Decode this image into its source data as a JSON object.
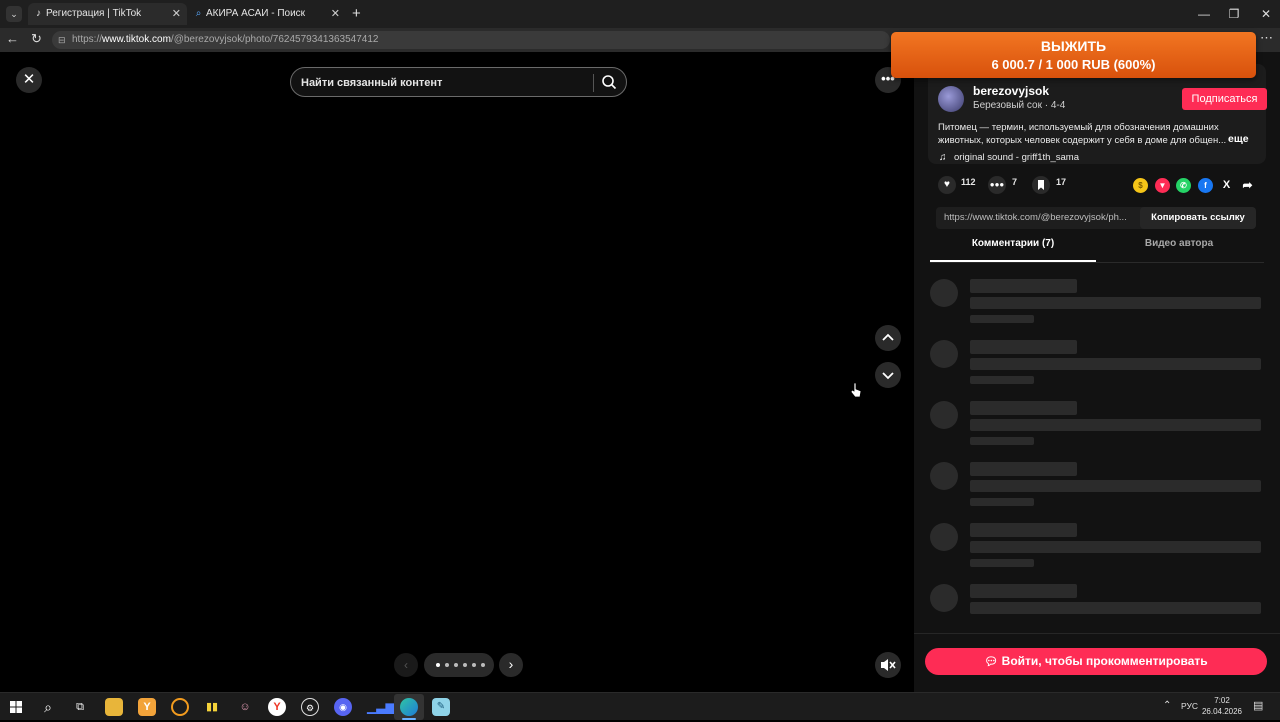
{
  "browser": {
    "tabs": [
      {
        "label": "Регистрация | TikTok",
        "favicon": "tiktok-icon"
      },
      {
        "label": "АКИРА АСАИ - Поиск",
        "favicon": "search-icon"
      }
    ],
    "url_prefix": "https://",
    "url_domain": "www.tiktok.com",
    "url_path": "/@berezovyjsok/photo/7624579341363547412"
  },
  "viewer": {
    "search_placeholder": "Найти связанный контент"
  },
  "promo": {
    "line1": "ВЫЖИТЬ",
    "line2": "6 000.7 / 1 000 RUB (600%)"
  },
  "panel": {
    "username": "berezovyjsok",
    "nickname": "Березовый сок · 4-4",
    "follow_label": "Подписаться",
    "description_line1": "Питомец — термин, используемый для обозначения домашних",
    "description_line2": "животных, которых человек содержит у себя в доме для общен...",
    "more_label": "еще",
    "sound": "original sound - griff1th_sama",
    "likes": "112",
    "comments": "7",
    "saves": "17",
    "link_text": "https://www.tiktok.com/@berezovyjsok/ph...",
    "copy_label": "Копировать ссылку",
    "tab_comments": "Комментарии (7)",
    "tab_author": "Видео автора",
    "login_label": "Войти, чтобы прокомментировать"
  },
  "taskbar": {
    "lang": "РУС",
    "time": "7:02",
    "date": "26.04.2026"
  },
  "colors": {
    "accent": "#fe2c55",
    "promo": "#e8641a"
  }
}
